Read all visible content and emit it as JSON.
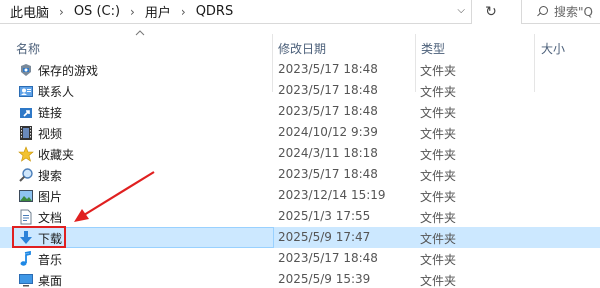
{
  "address": {
    "crumbs": [
      "此电脑",
      "OS (C:)",
      "用户",
      "QDRS"
    ],
    "search_placeholder": "搜索\"Q"
  },
  "columns": {
    "name": "名称",
    "date": "修改日期",
    "type": "类型",
    "size": "大小"
  },
  "rows": [
    {
      "name": "保存的游戏",
      "date": "2023/5/17 18:48",
      "type": "文件夹",
      "icon": "saved-games-icon"
    },
    {
      "name": "联系人",
      "date": "2023/5/17 18:48",
      "type": "文件夹",
      "icon": "contacts-icon"
    },
    {
      "name": "链接",
      "date": "2023/5/17 18:48",
      "type": "文件夹",
      "icon": "links-icon"
    },
    {
      "name": "视频",
      "date": "2024/10/12 9:39",
      "type": "文件夹",
      "icon": "videos-icon"
    },
    {
      "name": "收藏夹",
      "date": "2024/3/11 18:18",
      "type": "文件夹",
      "icon": "favorites-icon"
    },
    {
      "name": "搜索",
      "date": "2023/5/17 18:48",
      "type": "文件夹",
      "icon": "searches-icon"
    },
    {
      "name": "图片",
      "date": "2023/12/14 15:19",
      "type": "文件夹",
      "icon": "pictures-icon"
    },
    {
      "name": "文档",
      "date": "2025/1/3 17:55",
      "type": "文件夹",
      "icon": "documents-icon"
    },
    {
      "name": "下载",
      "date": "2025/5/9 17:47",
      "type": "文件夹",
      "icon": "downloads-icon",
      "selected": true
    },
    {
      "name": "音乐",
      "date": "2023/5/17 18:48",
      "type": "文件夹",
      "icon": "music-icon"
    },
    {
      "name": "桌面",
      "date": "2025/5/9 15:39",
      "type": "文件夹",
      "icon": "desktop-icon"
    }
  ],
  "colors": {
    "selection_bg": "#cce8ff",
    "selection_border": "#99d1ff",
    "annotation_red": "#e02020",
    "header_text": "#4c607a"
  }
}
